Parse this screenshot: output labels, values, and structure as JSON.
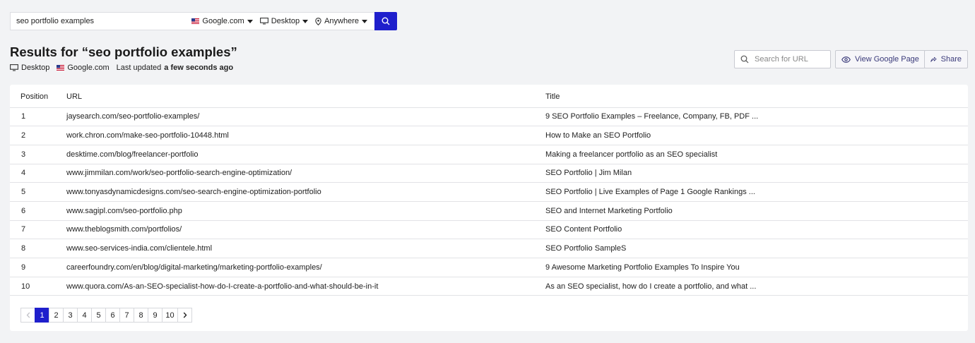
{
  "search": {
    "query": "seo portfolio examples",
    "engine": "Google.com",
    "device": "Desktop",
    "location": "Anywhere"
  },
  "heading": {
    "title": "Results for “seo portfolio examples”",
    "device": "Desktop",
    "engine": "Google.com",
    "updated_prefix": "Last updated",
    "updated_value": "a few seconds ago"
  },
  "controls": {
    "url_search_placeholder": "Search for URL",
    "view_google_label": "View Google Page",
    "share_label": "Share"
  },
  "table": {
    "headers": {
      "position": "Position",
      "url": "URL",
      "title": "Title"
    },
    "rows": [
      {
        "position": "1",
        "url": "jaysearch.com/seo-portfolio-examples/",
        "title": "9 SEO Portfolio Examples – Freelance, Company, FB, PDF ..."
      },
      {
        "position": "2",
        "url": "work.chron.com/make-seo-portfolio-10448.html",
        "title": "How to Make an SEO Portfolio"
      },
      {
        "position": "3",
        "url": "desktime.com/blog/freelancer-portfolio",
        "title": "Making a freelancer portfolio as an SEO specialist"
      },
      {
        "position": "4",
        "url": "www.jimmilan.com/work/seo-portfolio-search-engine-optimization/",
        "title": "SEO Portfolio | Jim Milan"
      },
      {
        "position": "5",
        "url": "www.tonyasdynamicdesigns.com/seo-search-engine-optimization-portfolio",
        "title": "SEO Portfolio | Live Examples of Page 1 Google Rankings ..."
      },
      {
        "position": "6",
        "url": "www.sagipl.com/seo-portfolio.php",
        "title": "SEO and Internet Marketing Portfolio"
      },
      {
        "position": "7",
        "url": "www.theblogsmith.com/portfolios/",
        "title": "SEO Content Portfolio"
      },
      {
        "position": "8",
        "url": "www.seo-services-india.com/clientele.html",
        "title": "SEO Portfolio SampleS"
      },
      {
        "position": "9",
        "url": "careerfoundry.com/en/blog/digital-marketing/marketing-portfolio-examples/",
        "title": "9 Awesome Marketing Portfolio Examples To Inspire You"
      },
      {
        "position": "10",
        "url": "www.quora.com/As-an-SEO-specialist-how-do-I-create-a-portfolio-and-what-should-be-in-it",
        "title": "As an SEO specialist, how do I create a portfolio, and what ..."
      }
    ]
  },
  "pagination": {
    "prev_icon": "chevron-left-icon",
    "next_icon": "chevron-right-icon",
    "pages": [
      "1",
      "2",
      "3",
      "4",
      "5",
      "6",
      "7",
      "8",
      "9",
      "10"
    ],
    "current": "1"
  },
  "colors": {
    "accent": "#1f1fcc",
    "background": "#f2f3f5",
    "border": "#e2e3e6"
  }
}
